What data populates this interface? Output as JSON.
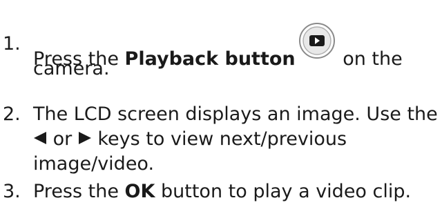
{
  "steps": [
    {
      "number": "1.",
      "prefix": "Press the ",
      "bold": "Playback button",
      "icon": "playback-button-icon",
      "suffix_line1": " on the",
      "line2": "camera."
    },
    {
      "number": "2.",
      "line1": "The LCD screen displays an image. Use the",
      "left_key_icon": "left-triangle-icon",
      "or_text": " or ",
      "right_key_icon": "right-triangle-icon",
      "line2_suffix": " keys to view next/previous",
      "line3": "image/video."
    },
    {
      "number": "3.",
      "prefix": "Press the ",
      "bold": "OK",
      "suffix": " button to play a video clip."
    }
  ]
}
